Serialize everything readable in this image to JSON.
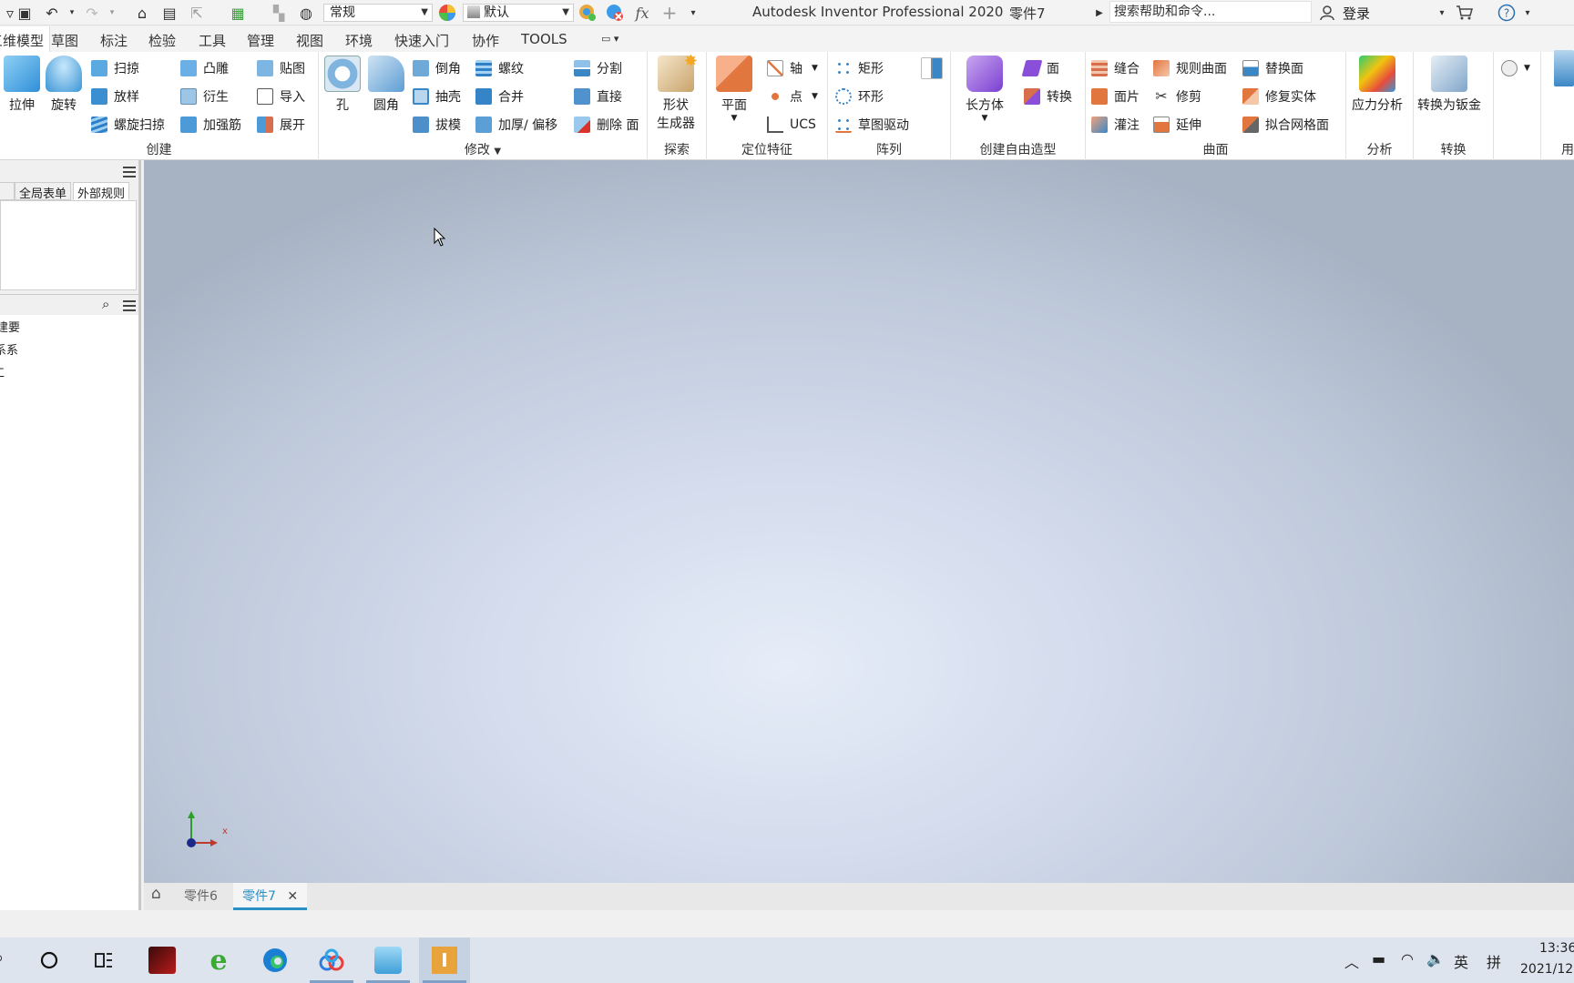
{
  "titlebar": {
    "style_dropdown": "常规",
    "appearance_dropdown": "默认",
    "app_title": "Autodesk Inventor Professional 2020",
    "doc_title": "零件7",
    "search_placeholder": "搜索帮助和命令...",
    "login": "登录"
  },
  "ribbon_tabs": [
    "三维模型",
    "草图",
    "标注",
    "检验",
    "工具",
    "管理",
    "视图",
    "环境",
    "快速入门",
    "协作",
    "TOOLS"
  ],
  "ribbon": {
    "create": {
      "label": "创建",
      "extrude": "拉伸",
      "revolve": "旋转",
      "sweep": "扫掠",
      "loft": "放样",
      "coil": "螺旋扫掠",
      "emboss": "凸雕",
      "derive": "衍生",
      "rib": "加强筋",
      "decal": "贴图",
      "import": "导入",
      "unwrap": "展开"
    },
    "modify": {
      "label": "修改",
      "hole": "孔",
      "fillet": "圆角",
      "chamfer": "倒角",
      "shell": "抽壳",
      "draft": "拔模",
      "thread": "螺纹",
      "combine": "合并",
      "thicken": "加厚/ 偏移",
      "split": "分割",
      "direct": "直接",
      "delete_face": "删除 面"
    },
    "explore": {
      "label": "探索",
      "shape_gen_1": "形状",
      "shape_gen_2": "生成器"
    },
    "work_features": {
      "label": "定位特征",
      "plane": "平面",
      "axis": "轴",
      "point": "点",
      "ucs": "UCS"
    },
    "pattern": {
      "label": "阵列",
      "rect": "矩形",
      "circ": "环形",
      "sketch_driven": "草图驱动"
    },
    "freeform": {
      "label": "创建自由造型",
      "box": "长方体",
      "face": "面",
      "convert": "转换"
    },
    "surface": {
      "label": "曲面",
      "stitch": "缝合",
      "patch": "面片",
      "sculpt": "灌注",
      "ruled": "规则曲面",
      "trim": "修剪",
      "extend": "延伸",
      "replace_face": "替换面",
      "repair": "修复实体",
      "mesh_face": "拟合网格面"
    },
    "analysis": {
      "label": "分析",
      "stress": "应力分析"
    },
    "convert": {
      "label": "转换",
      "sheet_metal": "转换为钣金"
    },
    "extra_label": "用"
  },
  "left_panel": {
    "tabs": [
      "全局表单",
      "外部规则"
    ],
    "tree": [
      "建要",
      "系系",
      "工"
    ]
  },
  "viewport": {
    "axis_x_label": "x"
  },
  "doc_tabs": [
    "零件6",
    "零件7"
  ],
  "taskbar": {
    "lang": "英",
    "ime": "拼",
    "time": "13:36",
    "date": "2021/12"
  },
  "colors": {
    "accent": "#2a8fc4",
    "viewport_center": "#e6edf8",
    "viewport_edge": "#a7b2c3"
  }
}
